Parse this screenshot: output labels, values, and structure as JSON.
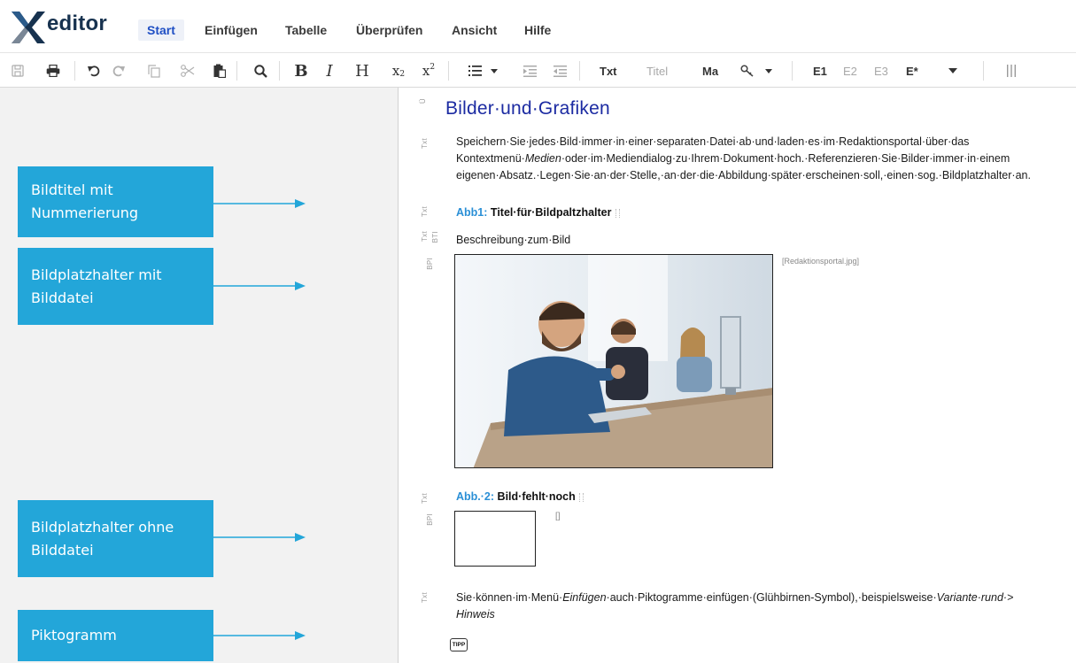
{
  "app": {
    "logo_text": "editor"
  },
  "menu": {
    "tabs": [
      "Start",
      "Einfügen",
      "Tabelle",
      "Überprüfen",
      "Ansicht",
      "Hilfe"
    ],
    "active": "Start"
  },
  "toolbar": {
    "style_buttons": {
      "txt": "Txt",
      "titel": "Titel",
      "ma": "Ma",
      "e1": "E1",
      "e2": "E2",
      "e3": "E3",
      "e_star": "E*"
    },
    "icons": [
      "save-icon",
      "print-icon",
      "undo-icon",
      "redo-icon",
      "copy-icon",
      "cut-icon",
      "paste-icon",
      "search-icon",
      "bold-icon",
      "italic-icon",
      "heading-icon",
      "subscript-icon",
      "superscript-icon",
      "list-icon",
      "indent-icon",
      "outdent-icon",
      "key-icon",
      "columns-icon"
    ]
  },
  "callouts": [
    {
      "text": "Bildtitel mit Nummerierung"
    },
    {
      "text": "Bildplatzhalter mit Bilddatei"
    },
    {
      "text": "Bildplatzhalter ohne Bilddatei"
    },
    {
      "text": "Piktogramm"
    }
  ],
  "colors": {
    "callout": "#23a6d9",
    "heading": "#1c2ba2",
    "caption_number": "#2a8fd6",
    "active_tab": "#1f4fc4"
  },
  "document": {
    "heading": "Bilder·und·Grafiken",
    "tags": {
      "heading": "Ü",
      "txt": "Txt",
      "bti": "BTI",
      "bp": "BPI"
    },
    "para1": {
      "line1": "Speichern·Sie·jedes·Bild·immer·in·einer·separaten·Datei·ab·und·laden·es·im·Redaktionsportal·über·das",
      "line2_pre": "Kontextmenü·",
      "line2_em": "Medien",
      "line2_post": "·oder·im·Mediendialog·zu·Ihrem·Dokument·hoch.·Referenzieren·Sie·Bilder·immer·in·einem",
      "line3": "eigenen·Absatz.·Legen·Sie·an·der·Stelle,·an·der·die·Abbildung·später·erscheinen·soll,·einen·sog.·Bildplatzhalter·an."
    },
    "figure1": {
      "number": "Abb1:",
      "title": "Titel·für·Bildpaltzhalter",
      "description": "Beschreibung·zum·Bild",
      "filename": "[Redaktionsportal.jpg]"
    },
    "figure2": {
      "number": "Abb.·2:",
      "title": "Bild·fehlt·noch",
      "placeholder": "[]"
    },
    "para2": {
      "pre": "Sie·können·im·Menü·",
      "em1": "Einfügen",
      "mid": "·auch·Piktogramme·einfügen·(Glühbirnen-Symbol),·beispielsweise·",
      "em2": "Variante·rund·>",
      "line2_em": "Hinweis"
    },
    "tipp": "TIPP"
  }
}
